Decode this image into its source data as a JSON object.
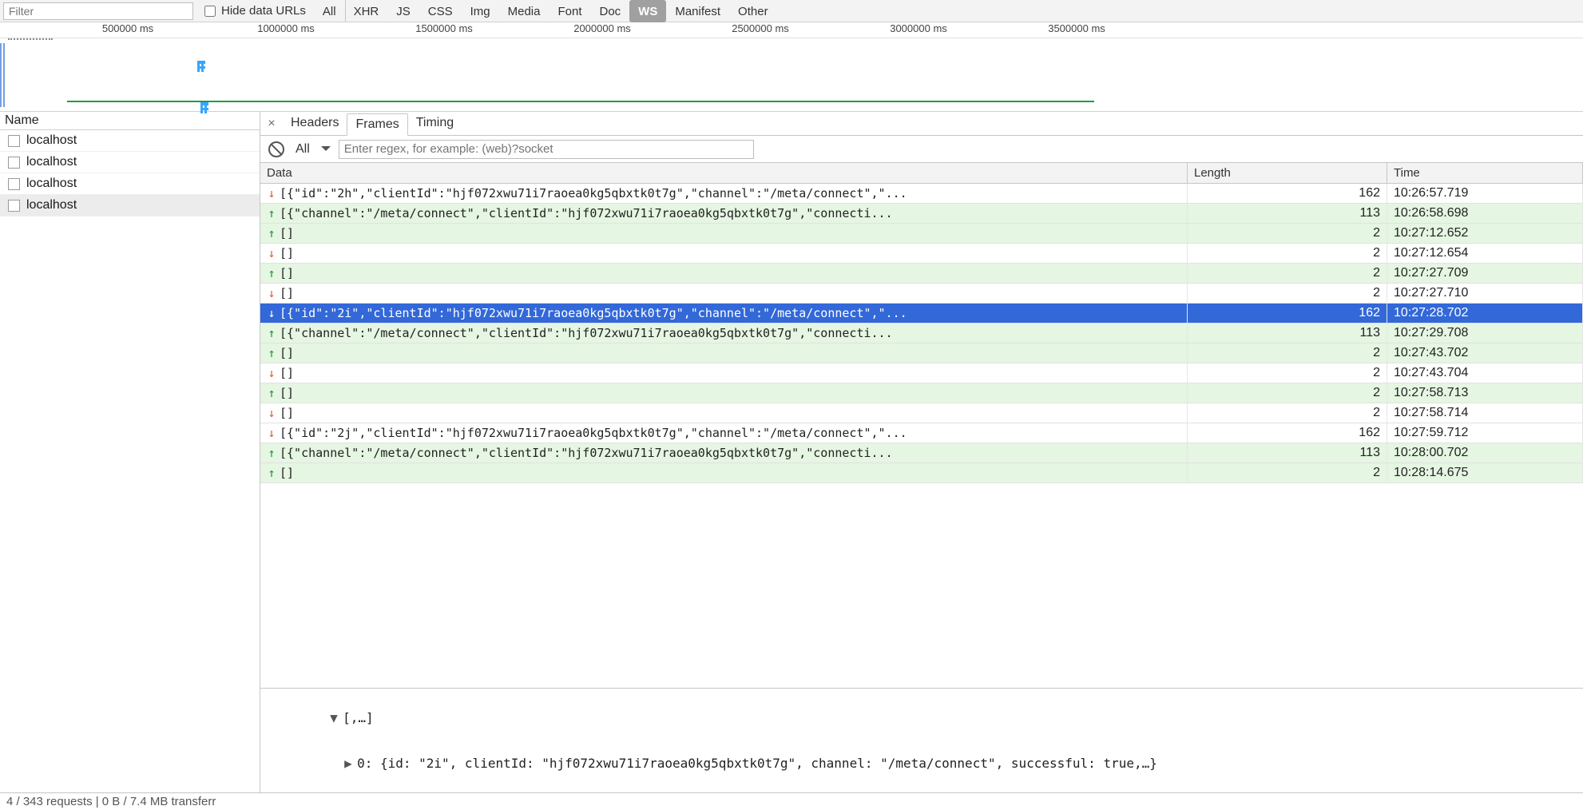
{
  "toolbar": {
    "filter_placeholder": "Filter",
    "hide_data_urls_label": "Hide data URLs",
    "tabs": [
      "All",
      "XHR",
      "JS",
      "CSS",
      "Img",
      "Media",
      "Font",
      "Doc",
      "WS",
      "Manifest",
      "Other"
    ],
    "active_tab": "WS"
  },
  "timeline": {
    "ticks": [
      "500000 ms",
      "1000000 ms",
      "1500000 ms",
      "2000000 ms",
      "2500000 ms",
      "3000000 ms",
      "3500000 ms"
    ]
  },
  "left": {
    "header": "Name",
    "requests": [
      {
        "label": "localhost",
        "selected": false
      },
      {
        "label": "localhost",
        "selected": false
      },
      {
        "label": "localhost",
        "selected": false
      },
      {
        "label": "localhost",
        "selected": true
      }
    ]
  },
  "details": {
    "tabs": [
      "Headers",
      "Frames",
      "Timing"
    ],
    "active_tab": "Frames",
    "frames_filter": {
      "all_label": "All",
      "regex_placeholder": "Enter regex, for example: (web)?socket"
    }
  },
  "frames": {
    "columns": [
      "Data",
      "Length",
      "Time"
    ],
    "rows": [
      {
        "dir": "recv",
        "data": "[{\"id\":\"2h\",\"clientId\":\"hjf072xwu71i7raoea0kg5qbxtk0t7g\",\"channel\":\"/meta/connect\",\"...",
        "length": 162,
        "time": "10:26:57.719",
        "selected": false
      },
      {
        "dir": "sent",
        "data": "[{\"channel\":\"/meta/connect\",\"clientId\":\"hjf072xwu71i7raoea0kg5qbxtk0t7g\",\"connecti...",
        "length": 113,
        "time": "10:26:58.698",
        "selected": false
      },
      {
        "dir": "sent",
        "data": "[]",
        "length": 2,
        "time": "10:27:12.652",
        "selected": false
      },
      {
        "dir": "recv",
        "data": "[]",
        "length": 2,
        "time": "10:27:12.654",
        "selected": false
      },
      {
        "dir": "sent",
        "data": "[]",
        "length": 2,
        "time": "10:27:27.709",
        "selected": false
      },
      {
        "dir": "recv",
        "data": "[]",
        "length": 2,
        "time": "10:27:27.710",
        "selected": false
      },
      {
        "dir": "recv",
        "data": "[{\"id\":\"2i\",\"clientId\":\"hjf072xwu71i7raoea0kg5qbxtk0t7g\",\"channel\":\"/meta/connect\",\"...",
        "length": 162,
        "time": "10:27:28.702",
        "selected": true
      },
      {
        "dir": "sent",
        "data": "[{\"channel\":\"/meta/connect\",\"clientId\":\"hjf072xwu71i7raoea0kg5qbxtk0t7g\",\"connecti...",
        "length": 113,
        "time": "10:27:29.708",
        "selected": false
      },
      {
        "dir": "sent",
        "data": "[]",
        "length": 2,
        "time": "10:27:43.702",
        "selected": false
      },
      {
        "dir": "recv",
        "data": "[]",
        "length": 2,
        "time": "10:27:43.704",
        "selected": false
      },
      {
        "dir": "sent",
        "data": "[]",
        "length": 2,
        "time": "10:27:58.713",
        "selected": false
      },
      {
        "dir": "recv",
        "data": "[]",
        "length": 2,
        "time": "10:27:58.714",
        "selected": false
      },
      {
        "dir": "recv",
        "data": "[{\"id\":\"2j\",\"clientId\":\"hjf072xwu71i7raoea0kg5qbxtk0t7g\",\"channel\":\"/meta/connect\",\"...",
        "length": 162,
        "time": "10:27:59.712",
        "selected": false
      },
      {
        "dir": "sent",
        "data": "[{\"channel\":\"/meta/connect\",\"clientId\":\"hjf072xwu71i7raoea0kg5qbxtk0t7g\",\"connecti...",
        "length": 113,
        "time": "10:28:00.702",
        "selected": false
      },
      {
        "dir": "sent",
        "data": "[]",
        "length": 2,
        "time": "10:28:14.675",
        "selected": false
      }
    ]
  },
  "preview": {
    "line1_prefix": "▼",
    "line1": "[,…]",
    "line2_prefix": "▶",
    "line2": "0: {id: \"2i\", clientId: \"hjf072xwu71i7raoea0kg5qbxtk0t7g\", channel: \"/meta/connect\", successful: true,…}"
  },
  "status_bar": "4 / 343 requests | 0 B / 7.4 MB transferr"
}
